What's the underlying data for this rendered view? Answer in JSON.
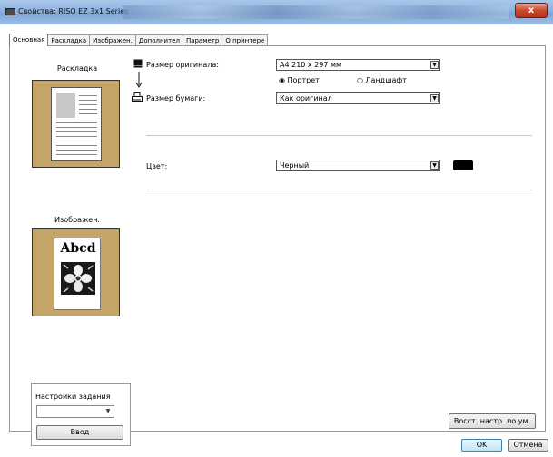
{
  "window": {
    "title": "Свойства: RISO EZ 3x1 Series",
    "close_label": "x"
  },
  "tabs": [
    {
      "label": "Основная",
      "active": true
    },
    {
      "label": "Раскладка",
      "active": false
    },
    {
      "label": "Изображен.",
      "active": false
    },
    {
      "label": "Дополнител",
      "active": false
    },
    {
      "label": "Параметр",
      "active": false
    },
    {
      "label": "О принтере",
      "active": false
    }
  ],
  "left": {
    "layout_label": "Раскладка",
    "image_label": "Изображен.",
    "image_sample_text": "Abcd",
    "job_settings_label": "Настройки задания",
    "job_combo_value": "",
    "enter_button": "Ввод"
  },
  "form": {
    "original_size_label": "Размер оригинала:",
    "original_size_value": "A4 210 x 297 мм",
    "orientation_portrait": "Портрет",
    "orientation_landscape": "Ландшафт",
    "orientation_selected": "portrait",
    "paper_size_label": "Размер бумаги:",
    "paper_size_value": "Как оригинал",
    "color_label": "Цвет:",
    "color_value": "Черный",
    "color_swatch": "#000000"
  },
  "buttons": {
    "restore_defaults": "Восст. настр. по ум.",
    "ok": "OK",
    "cancel": "Отмена"
  },
  "icons": {
    "original_size": "scanner-icon",
    "arrow": "down-arrow-icon",
    "paper_size": "printer-icon"
  }
}
